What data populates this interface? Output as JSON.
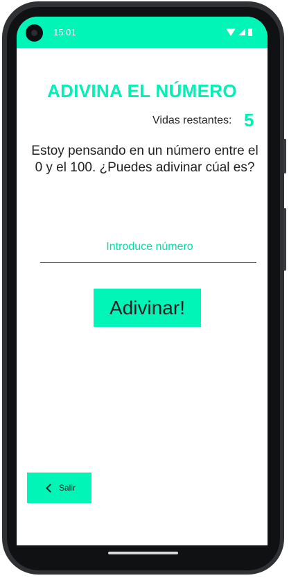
{
  "status_bar": {
    "time": "15:01",
    "accent": "#00f5b7"
  },
  "game": {
    "title": "ADIVINA EL NÚMERO",
    "lives_label": "Vidas restantes:",
    "lives_value": "5",
    "prompt": "Estoy pensando en un número entre el 0 y el 100. ¿Puedes adivinar cúal es?",
    "input": {
      "placeholder": "Introduce número",
      "value": ""
    },
    "guess_button": "Adivinar!",
    "exit_button": "Salir"
  }
}
